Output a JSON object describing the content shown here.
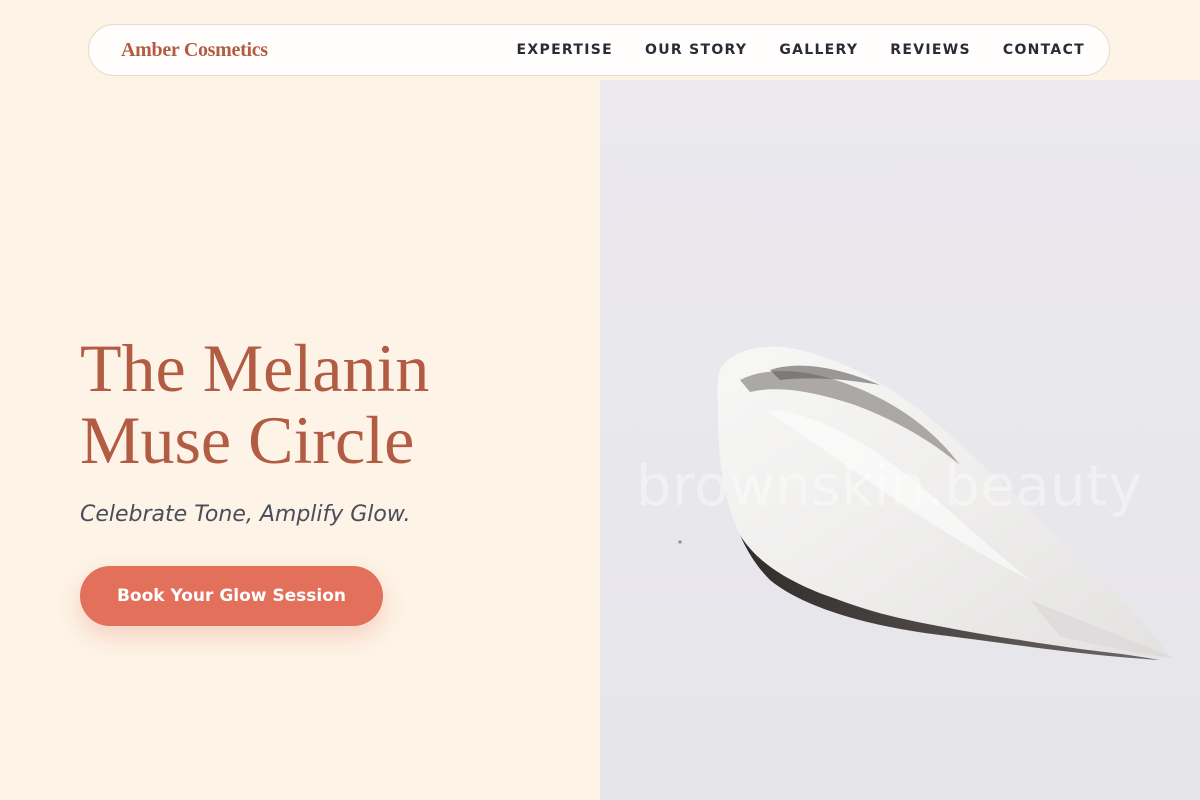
{
  "brand": {
    "name": "Amber Cosmetics"
  },
  "nav": {
    "items": [
      {
        "label": "EXPERTISE"
      },
      {
        "label": "OUR STORY"
      },
      {
        "label": "GALLERY"
      },
      {
        "label": "REVIEWS"
      },
      {
        "label": "CONTACT"
      }
    ]
  },
  "hero": {
    "title_line1": "The Melanin",
    "title_line2": "Muse Circle",
    "tagline": "Celebrate Tone, Amplify Glow.",
    "cta_label": "Book Your Glow Session",
    "image_watermark": "brownskin.beauty"
  },
  "colors": {
    "page_background": "#fdf3e6",
    "brand": "#b25c44",
    "cta": "#e2705a",
    "nav_text": "#2b2b35",
    "tagline": "#4a4d5a",
    "image_background": "#e9e8ed"
  }
}
